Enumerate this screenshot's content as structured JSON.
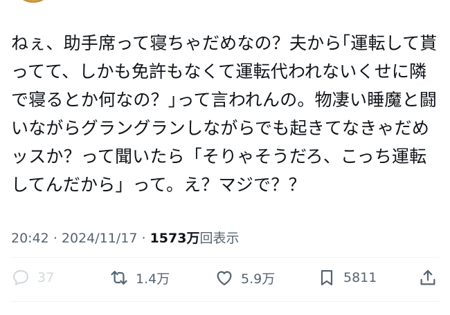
{
  "tweet": {
    "text": "ねぇ、助手席って寝ちゃだめなの？夫から｢運転して貰ってて、しかも免許もなくて運転代われないくせに隣で寝るとか何なの？｣って言われんの。物凄い睡魔と闘いながらグラングランしながらでも起きてなきゃだめッスか？って聞いたら「そりゃそうだろ、こっち運転してんだから」って。え？マジで？？",
    "time": "20:42",
    "separator": "·",
    "date": "2024/11/17",
    "separator2": "·",
    "views": "1573万",
    "views_label": "回表示"
  },
  "actions": {
    "reply_count": "37",
    "retweet_count": "1.4万",
    "like_count": "5.9万",
    "bookmark_count": "5811"
  },
  "icons": {
    "reply": "speech-bubble-icon",
    "retweet": "retweet-arrows-icon",
    "like": "heart-icon",
    "bookmark": "bookmark-icon",
    "share": "share-upload-icon"
  },
  "colors": {
    "text": "#0f1419",
    "secondary": "#536471",
    "muted": "#cfd9de"
  }
}
